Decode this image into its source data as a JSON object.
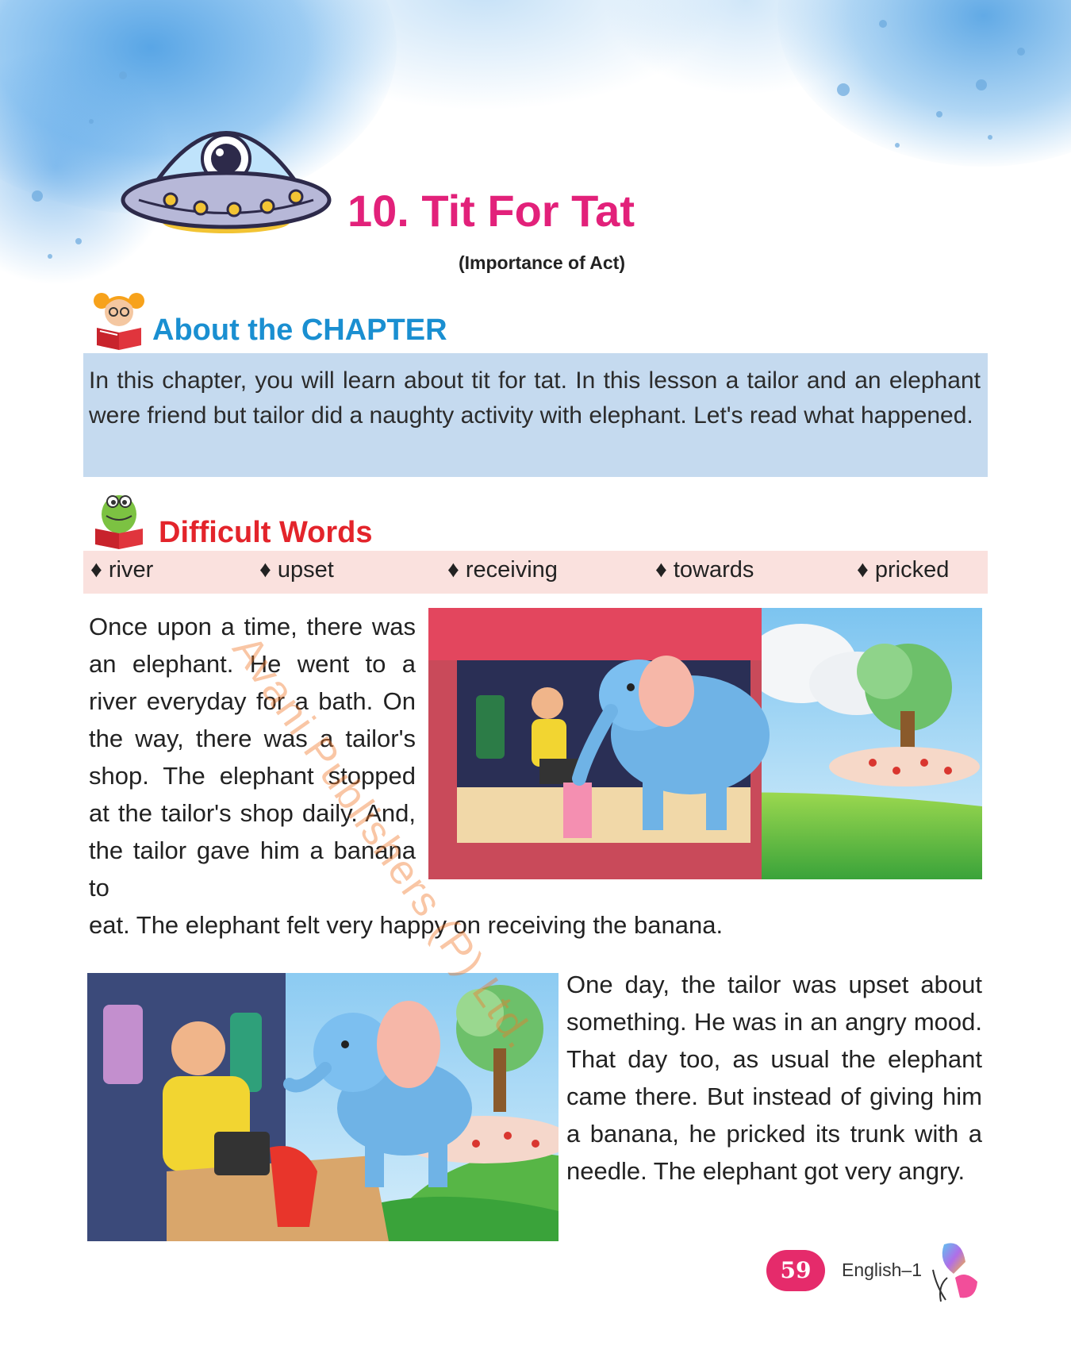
{
  "chapter": {
    "title": "10. Tit For Tat",
    "subtitle": "(Importance of Act)"
  },
  "about": {
    "heading": "About the CHAPTER",
    "text": "In this chapter, you will learn about tit for tat. In this lesson a tailor and an elephant were friend but tailor did a naughty activity with elephant. Let's read what happened."
  },
  "difficult_words": {
    "heading": "Difficult Words",
    "words": [
      "river",
      "upset",
      "receiving",
      "towards",
      "pricked"
    ]
  },
  "story": {
    "para1": "Once upon a time, there was an elephant. He went to a river everyday for a bath. On the way, there was a tailor's shop. The elephant stopped at the tailor's shop daily. And, the tailor gave him a banana to",
    "para1_tail": "eat. The elephant felt very happy on receiving the banana.",
    "para2": "One day, the tailor was upset about something. He was in an angry mood. That day too, as usual the elephant came there. But instead of giving him a banana, he pricked its trunk with a needle. The elephant got very angry."
  },
  "watermark": "Avani Publishers (P) Ltd.",
  "footer": {
    "page_number": "59",
    "book": "English–1"
  },
  "colors": {
    "title": "#e2217a",
    "about_heading": "#1a8fd1",
    "about_box": "#c5daef",
    "words_heading": "#e3242b",
    "words_bar": "#fae1de",
    "page_pill": "#e52b6b"
  },
  "icons": [
    "ufo-astronaut-icon",
    "girl-reading-icon",
    "croc-reading-icon",
    "butterfly-icon",
    "diamond-bullet-icon"
  ]
}
